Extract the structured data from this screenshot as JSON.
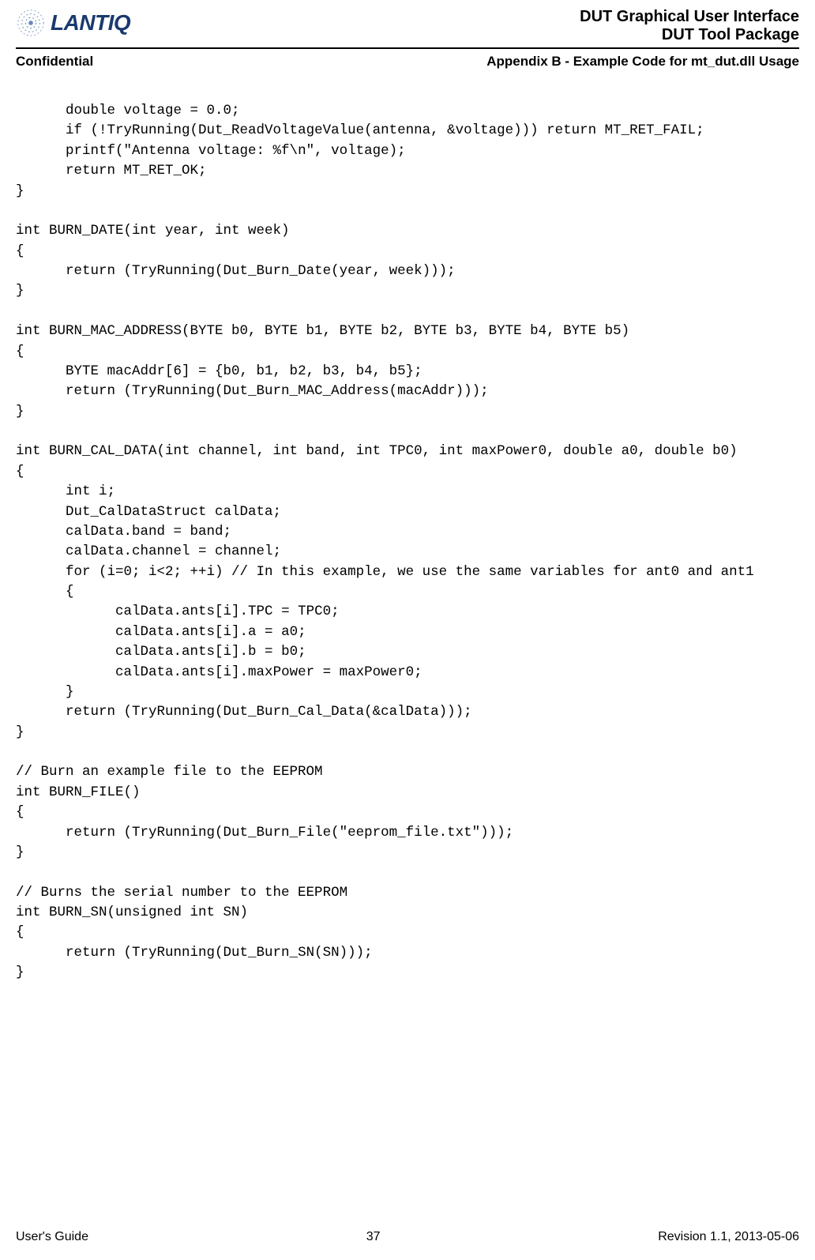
{
  "header": {
    "logo_text": "LANTIQ",
    "doc_title_1": "DUT Graphical User Interface",
    "doc_title_2": "DUT Tool Package"
  },
  "subheader": {
    "confidential": "Confidential",
    "appendix": "Appendix B - Example Code for mt_dut.dll Usage"
  },
  "code": "      double voltage = 0.0;\n      if (!TryRunning(Dut_ReadVoltageValue(antenna, &voltage))) return MT_RET_FAIL;\n      printf(\"Antenna voltage: %f\\n\", voltage);\n      return MT_RET_OK;\n}\n\nint BURN_DATE(int year, int week)\n{\n      return (TryRunning(Dut_Burn_Date(year, week)));\n}\n\nint BURN_MAC_ADDRESS(BYTE b0, BYTE b1, BYTE b2, BYTE b3, BYTE b4, BYTE b5)\n{\n      BYTE macAddr[6] = {b0, b1, b2, b3, b4, b5};\n      return (TryRunning(Dut_Burn_MAC_Address(macAddr)));\n}\n\nint BURN_CAL_DATA(int channel, int band, int TPC0, int maxPower0, double a0, double b0)\n{\n      int i;\n      Dut_CalDataStruct calData;\n      calData.band = band;\n      calData.channel = channel;\n      for (i=0; i<2; ++i) // In this example, we use the same variables for ant0 and ant1\n      {\n            calData.ants[i].TPC = TPC0;\n            calData.ants[i].a = a0;\n            calData.ants[i].b = b0;\n            calData.ants[i].maxPower = maxPower0;\n      }\n      return (TryRunning(Dut_Burn_Cal_Data(&calData)));\n}\n\n// Burn an example file to the EEPROM\nint BURN_FILE()\n{\n      return (TryRunning(Dut_Burn_File(\"eeprom_file.txt\")));\n}\n\n// Burns the serial number to the EEPROM\nint BURN_SN(unsigned int SN)\n{\n      return (TryRunning(Dut_Burn_SN(SN)));\n}",
  "footer": {
    "left": "User's Guide",
    "center": "37",
    "right": "Revision 1.1, 2013-05-06"
  }
}
